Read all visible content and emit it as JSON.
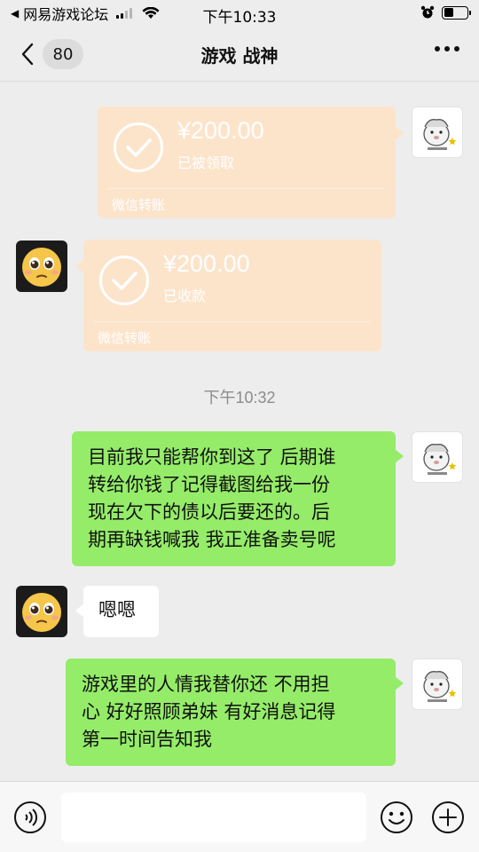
{
  "status_bar": {
    "back_glyph": "◀",
    "carrier": "网易游戏论坛",
    "time": "下午10:33"
  },
  "nav": {
    "unread_count": "80",
    "title": "游戏 战神"
  },
  "messages": {
    "transfer_sent": {
      "amount": "¥200.00",
      "status": "已被领取",
      "label": "微信转账"
    },
    "transfer_received": {
      "amount": "¥200.00",
      "status": "已收款",
      "label": "微信转账"
    },
    "timestamp": "下午10:32",
    "text1_lines": [
      "目前我只能帮你到这了 后期谁",
      "转给你钱了记得截图给我一份",
      "现在欠下的债以后要还的。后",
      "期再缺钱喊我 我正准备卖号呢"
    ],
    "reply": "嗯嗯",
    "text2_lines": [
      "游戏里的人情我替你还 不用担",
      "心 好好照顾弟妹 有好消息记得",
      "第一时间告知我"
    ]
  },
  "input_bar": {
    "placeholder": ""
  },
  "colors": {
    "background": "#ededed",
    "bubble_green": "#95ec69",
    "transfer_card": "#fce4cb"
  }
}
